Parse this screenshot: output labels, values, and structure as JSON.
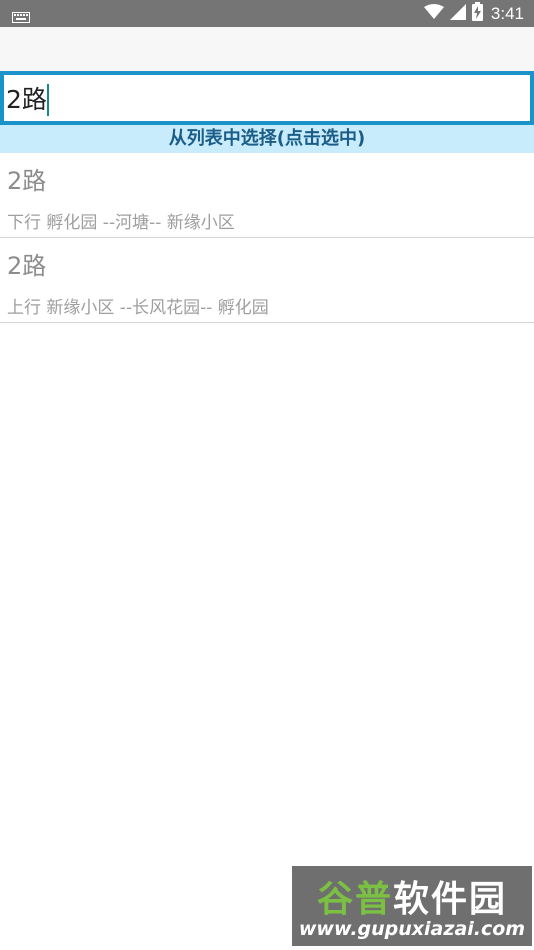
{
  "status_bar": {
    "time": "3:41",
    "icons": [
      "keyboard-icon",
      "wifi-icon",
      "cellular-signal-icon",
      "battery-charging-icon"
    ]
  },
  "search": {
    "value": "2路",
    "placeholder": ""
  },
  "banner": {
    "text": "从列表中选择(点击选中)"
  },
  "routes": [
    {
      "name": "2路",
      "description": "下行 孵化园 --河塘-- 新缘小区"
    },
    {
      "name": "2路",
      "description": "上行 新缘小区 --长风花园-- 孵化园"
    }
  ],
  "watermark": {
    "title_part1": "谷普",
    "title_part2": "软件园",
    "url": "www.gupuxiazai.com"
  },
  "colors": {
    "accent": "#1a93c9",
    "banner_bg": "#c8ecfb",
    "banner_text": "#1b5d89",
    "status_bar": "#757575"
  }
}
